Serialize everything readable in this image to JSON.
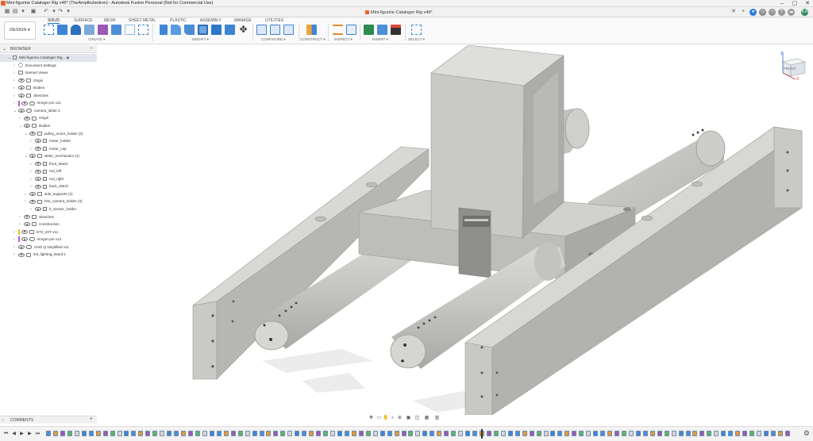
{
  "window": {
    "title": "Mini-figurine Cataloger Rig v46* (TheAmplituhedron) - Autodesk Fusion Personal (Not for Commercial Use)",
    "minimize": "–",
    "maximize": "▢",
    "close": "✕"
  },
  "tabbar": {
    "doc_tab_label": "Mini-figurine Cataloger Rig v46*",
    "doc_tab_close": "✕",
    "new_tab": "+",
    "avatar_initials": "KA"
  },
  "toolbar": {
    "workspace_button": "DESIGN ▾",
    "tabs": [
      "SOLID",
      "SURFACE",
      "MESH",
      "SHEET METAL",
      "PLASTIC",
      "ASSEMBLY",
      "MANAGE",
      "UTILITIES"
    ],
    "groups": [
      "CREATE ▾",
      "MODIFY ▾",
      "CONFIGURE ▾",
      "CONSTRUCT ▾",
      "INSPECT ▾",
      "INSERT ▾",
      "SELECT ▾"
    ]
  },
  "browser": {
    "header": "BROWSER",
    "tree": [
      {
        "label": "Mini-figurine Cataloger Rig...",
        "depth": 0,
        "icon": "doc",
        "root": true,
        "open": true
      },
      {
        "label": "Document Settings",
        "depth": 1,
        "icon": "gear-icon"
      },
      {
        "label": "Named Views",
        "depth": 1,
        "icon": "folder-icon"
      },
      {
        "label": "Origin",
        "depth": 1,
        "icon": "folder-icon",
        "eye": true
      },
      {
        "label": "Bodies",
        "depth": 1,
        "icon": "folder-icon",
        "eye": true
      },
      {
        "label": "Sketches",
        "depth": 1,
        "icon": "folder-icon",
        "eye": true
      },
      {
        "label": "mmgm-pm v11",
        "depth": 1,
        "icon": "component-icon",
        "eye": true,
        "mark": "#c455c4"
      },
      {
        "label": "camera_slider:1",
        "depth": 1,
        "icon": "component-icon",
        "eye": true,
        "open": true
      },
      {
        "label": "Origin",
        "depth": 2,
        "icon": "folder-icon",
        "eye": true
      },
      {
        "label": "Bodies",
        "depth": 2,
        "icon": "folder-icon",
        "eye": true,
        "open": true
      },
      {
        "label": "pulley_motor_holder (2)",
        "depth": 3,
        "icon": "folder-icon",
        "eye": true,
        "open": true
      },
      {
        "label": "motor_holder",
        "depth": 4,
        "icon": "body-icon",
        "eye": true
      },
      {
        "label": "motor_cap",
        "depth": 4,
        "icon": "body-icon",
        "eye": true
      },
      {
        "label": "slider_mechanism (4)",
        "depth": 3,
        "icon": "folder-icon",
        "eye": true,
        "open": true
      },
      {
        "label": "front_stand",
        "depth": 4,
        "icon": "body-icon",
        "eye": true
      },
      {
        "label": "rod_left",
        "depth": 4,
        "icon": "body-icon",
        "eye": true
      },
      {
        "label": "rod_right",
        "depth": 4,
        "icon": "body-icon",
        "eye": true
      },
      {
        "label": "back_stand",
        "depth": 4,
        "icon": "body-icon",
        "eye": true
      },
      {
        "label": "side_supports (2)",
        "depth": 3,
        "icon": "folder-icon",
        "eye": true
      },
      {
        "label": "hris_camera_holder (4)",
        "depth": 3,
        "icon": "folder-icon",
        "eye": true
      },
      {
        "label": "ir_sensor_holder",
        "depth": 4,
        "icon": "body-icon",
        "eye": true
      },
      {
        "label": "Sketches",
        "depth": 2,
        "icon": "folder-icon",
        "eye": true
      },
      {
        "label": "Construction",
        "depth": 2,
        "icon": "folder-icon",
        "eye": true
      },
      {
        "label": "GT2_20T v11",
        "depth": 1,
        "icon": "folder-icon",
        "eye": true,
        "mark": "#e0c020"
      },
      {
        "label": "mmgm-pm v12",
        "depth": 1,
        "icon": "component-icon",
        "eye": true,
        "mark": "#c455c4"
      },
      {
        "label": "UNO Q simplified v11",
        "depth": 1,
        "icon": "component-icon",
        "eye": true
      },
      {
        "label": "led_lighting_stand:1",
        "depth": 1,
        "icon": "folder-icon",
        "eye": true
      }
    ]
  },
  "comments": {
    "label": "COMMENTS",
    "add": "+"
  },
  "viewcube": {
    "face_label": "FRONT",
    "axis_x": "X",
    "axis_z": "Z"
  },
  "timeline": {
    "controls": [
      "⏮",
      "◀",
      "▶",
      "▶",
      "⏭"
    ],
    "gear": "⚙"
  },
  "colors": {
    "accent": "#1a73c9",
    "model_light": "#d3d3cf",
    "model_mid": "#b9b9b5",
    "model_dark": "#9f9f9b"
  }
}
